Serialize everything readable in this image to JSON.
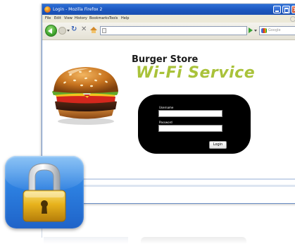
{
  "window": {
    "title": "Login - Mozilla Firefox 2"
  },
  "menubar": {
    "items": [
      "File",
      "Edit",
      "View",
      "History",
      "Bookmarks",
      "Tools",
      "Help"
    ]
  },
  "toolbar": {
    "url_value": "",
    "search_placeholder": "Google"
  },
  "page": {
    "brand_name": "Burger Store",
    "service_name": "Wi-Fi Service",
    "username_label": "Username",
    "password_label": "Password",
    "username_value": "",
    "password_value": "",
    "login_label": "Login"
  },
  "colors": {
    "accent_green": "#a9c23a",
    "panel_black": "#000000",
    "lock_tile_blue": "#2c7fe0",
    "lock_gold": "#e7b21c"
  },
  "icons": {
    "lock": "padlock-icon",
    "burger": "hamburger-image"
  }
}
